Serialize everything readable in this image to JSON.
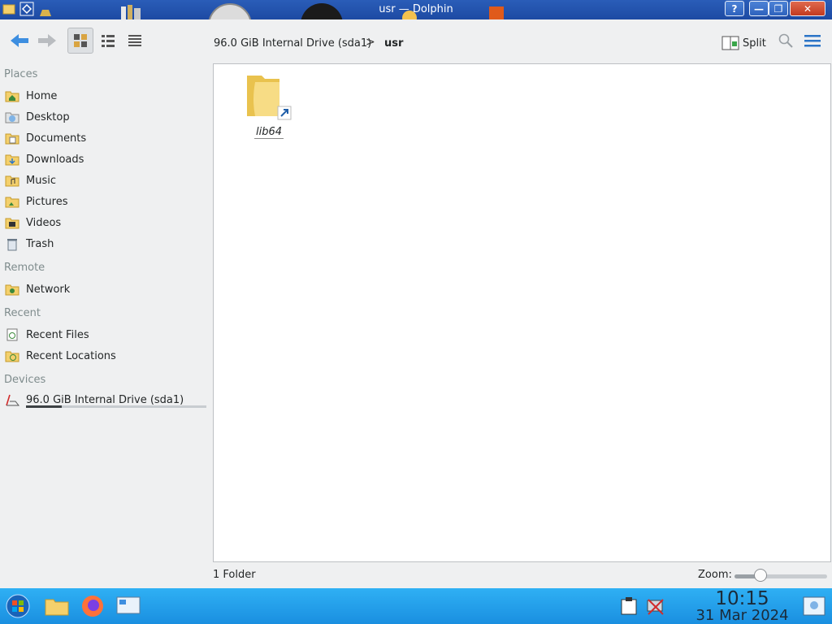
{
  "window": {
    "title": "usr — Dolphin",
    "help_label": "?",
    "minimize_label": "—",
    "maximize_label": "❐",
    "close_label": "✕"
  },
  "toolbar": {
    "back_icon": "arrow-left-icon",
    "forward_icon": "arrow-right-icon",
    "view_modes": [
      "icons-view",
      "compact-view",
      "details-view"
    ],
    "active_view": "icons-view",
    "split_label": "Split"
  },
  "breadcrumb": {
    "items": [
      "96.0 GiB Internal Drive (sda1)",
      "usr"
    ],
    "separator": ">"
  },
  "sidebar": {
    "sections": [
      {
        "title": "Places",
        "items": [
          {
            "label": "Home",
            "icon": "home-folder-icon"
          },
          {
            "label": "Desktop",
            "icon": "desktop-folder-icon"
          },
          {
            "label": "Documents",
            "icon": "documents-folder-icon"
          },
          {
            "label": "Downloads",
            "icon": "downloads-folder-icon"
          },
          {
            "label": "Music",
            "icon": "music-folder-icon"
          },
          {
            "label": "Pictures",
            "icon": "pictures-folder-icon"
          },
          {
            "label": "Videos",
            "icon": "videos-folder-icon"
          },
          {
            "label": "Trash",
            "icon": "trash-icon"
          }
        ]
      },
      {
        "title": "Remote",
        "items": [
          {
            "label": "Network",
            "icon": "network-folder-icon"
          }
        ]
      },
      {
        "title": "Recent",
        "items": [
          {
            "label": "Recent Files",
            "icon": "recent-files-icon"
          },
          {
            "label": "Recent Locations",
            "icon": "recent-locations-icon"
          }
        ]
      },
      {
        "title": "Devices",
        "items": [
          {
            "label": "96.0 GiB Internal Drive (sda1)",
            "icon": "drive-icon",
            "usage_fraction": 0.2
          }
        ]
      }
    ]
  },
  "files": [
    {
      "name": "lib64",
      "type": "folder-symlink",
      "icon": "folder-link-icon"
    }
  ],
  "statusbar": {
    "summary": "1 Folder",
    "zoom_label": "Zoom:",
    "zoom_fraction": 0.25
  },
  "taskbar": {
    "apps": [
      "start-icon",
      "file-manager-icon",
      "firefox-icon",
      "system-settings-icon"
    ],
    "tray": [
      "clipboard-icon",
      "network-disconnected-icon"
    ],
    "time": "10:15",
    "date": "31 Mar 2024"
  },
  "colors": {
    "titlebar": "#2a5db8",
    "taskbar": "#1a8fe0",
    "accent": "#2b74c7",
    "folder": "#f4d06c"
  }
}
